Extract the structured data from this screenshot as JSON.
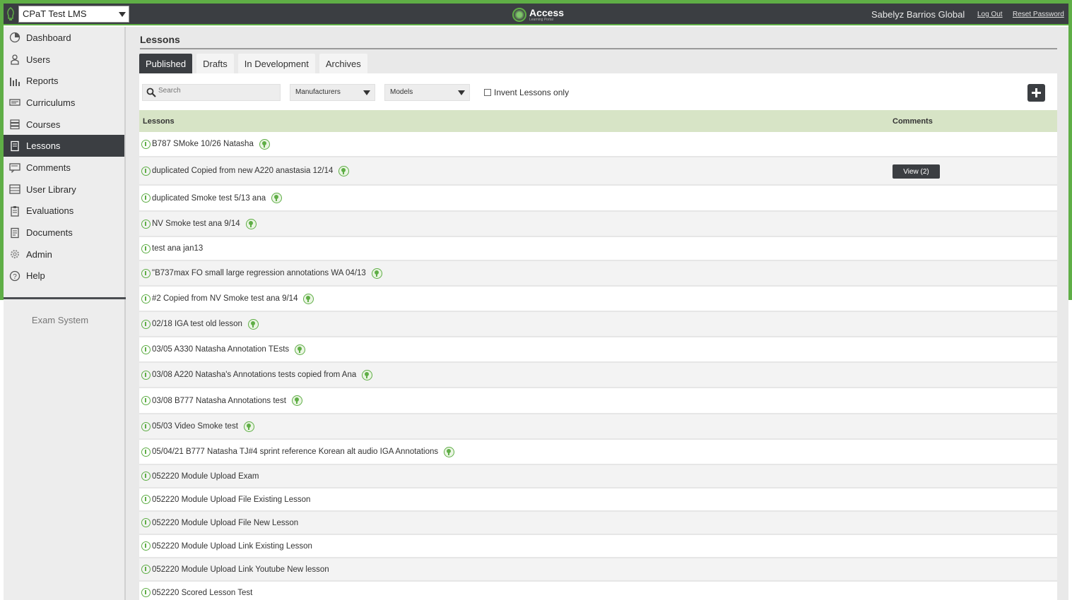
{
  "app": {
    "org_selector": "CPaT Test LMS",
    "logo_text": "Access",
    "logo_sub": "Learning Portal",
    "user_name": "Sabelyz Barrios Global",
    "logout": "Log Out",
    "reset_password": "Reset Password"
  },
  "sidebar": {
    "items": [
      {
        "label": "Dashboard",
        "icon": "dashboard-icon"
      },
      {
        "label": "Users",
        "icon": "user-icon"
      },
      {
        "label": "Reports",
        "icon": "bar-chart-icon"
      },
      {
        "label": "Curriculums",
        "icon": "curriculum-icon"
      },
      {
        "label": "Courses",
        "icon": "courses-icon"
      },
      {
        "label": "Lessons",
        "icon": "lesson-icon",
        "active": true
      },
      {
        "label": "Comments",
        "icon": "comment-icon"
      },
      {
        "label": "User Library",
        "icon": "library-icon"
      },
      {
        "label": "Evaluations",
        "icon": "clipboard-icon"
      },
      {
        "label": "Documents",
        "icon": "document-icon"
      },
      {
        "label": "Admin",
        "icon": "gear-icon"
      },
      {
        "label": "Help",
        "icon": "help-icon"
      }
    ],
    "exam_system": "Exam System"
  },
  "main": {
    "title": "Lessons",
    "tabs": [
      {
        "label": "Published",
        "active": true
      },
      {
        "label": "Drafts"
      },
      {
        "label": "In Development"
      },
      {
        "label": "Archives"
      }
    ],
    "search_placeholder": "Search",
    "manufacturers": "Manufacturers",
    "models": "Models",
    "invent_only": "Invent Lessons only",
    "table": {
      "col_lessons": "Lessons",
      "col_comments": "Comments",
      "rows": [
        {
          "title": "B787 SMoke 10/26 Natasha",
          "published": true
        },
        {
          "title": "duplicated Copied from new A220 anastasia 12/14",
          "published": true,
          "comments": "View (2)"
        },
        {
          "title": "duplicated Smoke test 5/13 ana",
          "published": true
        },
        {
          "title": "NV Smoke test ana 9/14",
          "published": true
        },
        {
          "title": "test ana jan13",
          "published": false
        },
        {
          "title": "\"B737max FO small large regression annotations WA 04/13",
          "published": true
        },
        {
          "title": "#2 Copied from NV Smoke test ana 9/14",
          "published": true
        },
        {
          "title": "02/18 IGA test old lesson",
          "published": true
        },
        {
          "title": "03/05 A330 Natasha Annotation TEsts",
          "published": true
        },
        {
          "title": "03/08 A220 Natasha's Annotations tests copied from Ana",
          "published": true
        },
        {
          "title": "03/08 B777 Natasha Annotations test",
          "published": true
        },
        {
          "title": "05/03 Video Smoke test",
          "published": true
        },
        {
          "title": "05/04/21 B777 Natasha TJ#4 sprint reference Korean alt audio IGA Annotations",
          "published": true
        },
        {
          "title": "052220 Module Upload Exam",
          "published": false
        },
        {
          "title": "052220 Module Upload File Existing Lesson",
          "published": false
        },
        {
          "title": "052220 Module Upload File New Lesson",
          "published": false
        },
        {
          "title": "052220 Module Upload Link Existing Lesson",
          "published": false
        },
        {
          "title": "052220 Module Upload Link Youtube New lesson",
          "published": false
        },
        {
          "title": "052220 Scored Lesson Test",
          "published": false
        }
      ]
    }
  }
}
